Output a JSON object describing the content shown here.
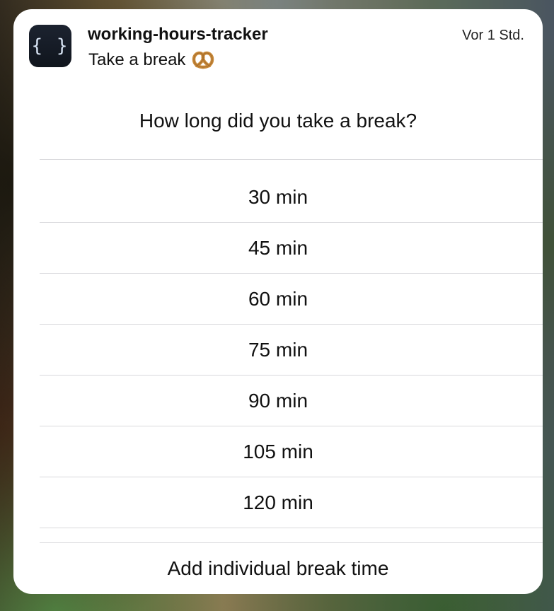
{
  "notification": {
    "app_name": "working-hours-tracker",
    "subtitle": "Take a break",
    "timestamp": "Vor 1 Std.",
    "app_icon_glyph": "{ }",
    "subtitle_icon": "pretzel-icon"
  },
  "prompt": {
    "text": "How long did you take a break?"
  },
  "options": [
    {
      "label": "30 min"
    },
    {
      "label": "45 min"
    },
    {
      "label": "60 min"
    },
    {
      "label": "75 min"
    },
    {
      "label": "90 min"
    },
    {
      "label": "105 min"
    },
    {
      "label": "120 min"
    }
  ],
  "actions": {
    "add_individual_label": "Add individual break time"
  },
  "colors": {
    "card_background": "#ffffff",
    "separator": "#d9d9dc",
    "app_icon_background": "#161c26",
    "text": "#111111"
  }
}
